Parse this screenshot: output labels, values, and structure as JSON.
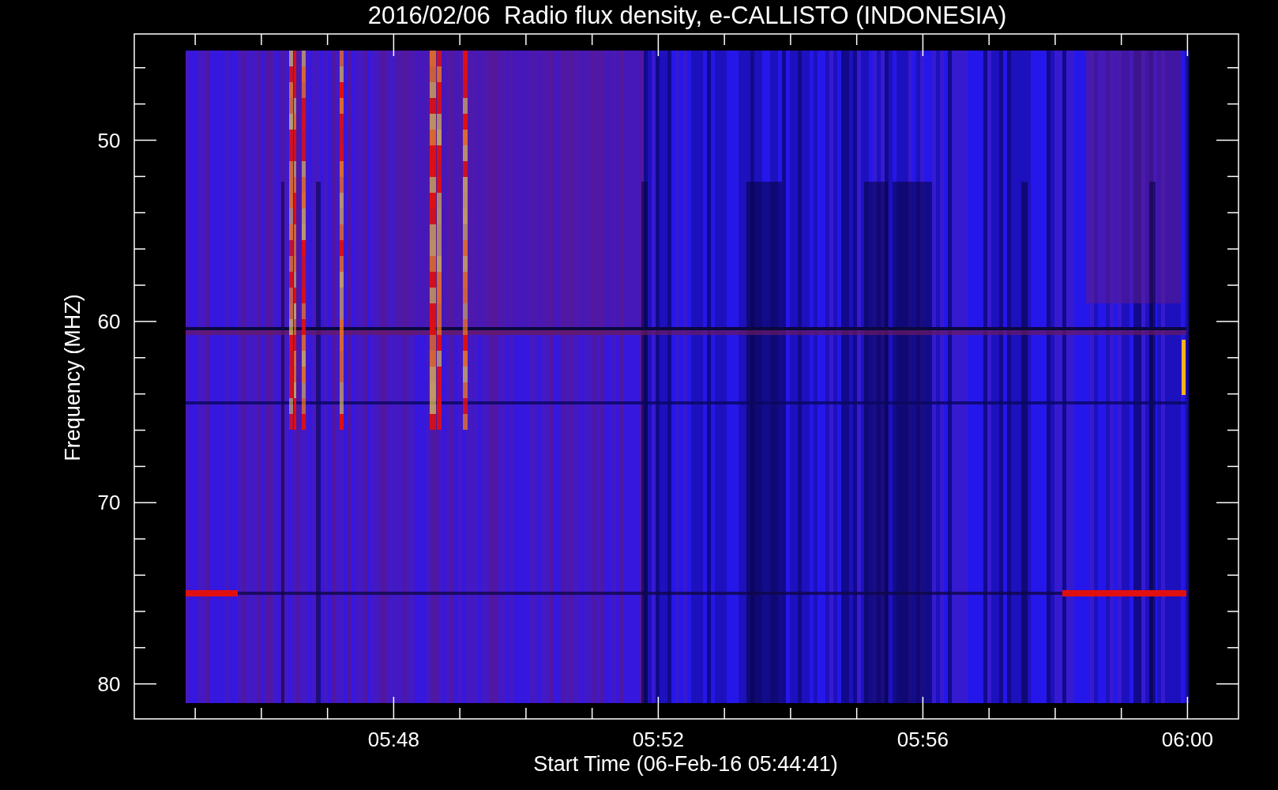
{
  "title": "2016/02/06  Radio flux density, e-CALLISTO (INDONESIA)",
  "y_axis": {
    "label": "Frequency (MHZ)",
    "ticks": [
      "50",
      "60",
      "70",
      "80"
    ]
  },
  "x_axis": {
    "label": "Start Time (06-Feb-16 05:44:41)",
    "ticks": [
      "05:48",
      "05:52",
      "05:56",
      "06:00"
    ]
  }
}
